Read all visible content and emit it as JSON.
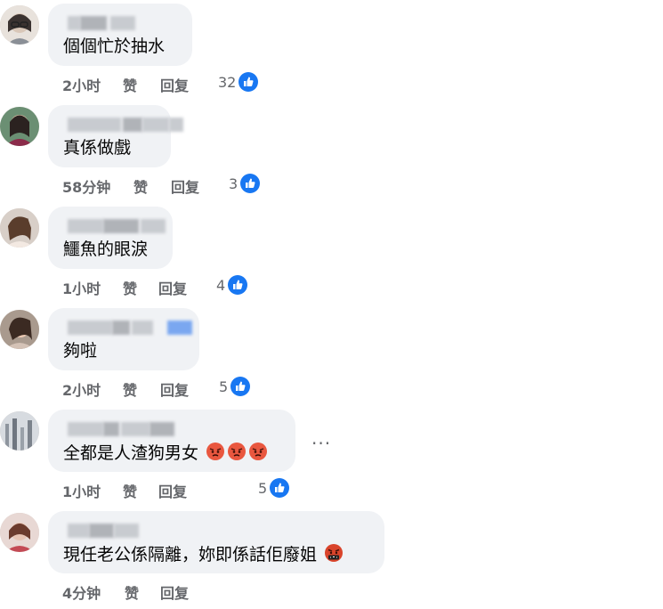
{
  "comments": [
    {
      "text": "個個忙於抽水",
      "time": "2小时",
      "like": "赞",
      "reply": "回复",
      "reactions": "32",
      "reaction_icon": "like-thumb-blue",
      "emoji": []
    },
    {
      "text": "真係做戲",
      "time": "58分钟",
      "like": "赞",
      "reply": "回复",
      "reactions": "3",
      "reaction_icon": "like-thumb-blue",
      "emoji": []
    },
    {
      "text": "鱷魚的眼淚",
      "time": "1小时",
      "like": "赞",
      "reply": "回复",
      "reactions": "4",
      "reaction_icon": "like-thumb-blue",
      "emoji": []
    },
    {
      "text": "夠啦",
      "time": "2小时",
      "like": "赞",
      "reply": "回复",
      "reactions": "5",
      "reaction_icon": "like-thumb-blue",
      "emoji": []
    },
    {
      "text": "全都是人渣狗男女",
      "time": "1小时",
      "like": "赞",
      "reply": "回复",
      "reactions": "5",
      "reaction_icon": "like-thumb-blue",
      "emoji": [
        "angry-face-icon",
        "angry-face-icon",
        "angry-face-icon"
      ],
      "more": "···"
    },
    {
      "text": "現任老公係隔離，妳即係話佢廢姐",
      "time": "4分钟",
      "like": "赞",
      "reply": "回复",
      "reactions": "",
      "emoji": [
        "cursing-face-icon"
      ]
    }
  ],
  "colors": {
    "bubble": "#f0f2f5",
    "meta": "#65676b",
    "like_blue": "#1877f2"
  }
}
